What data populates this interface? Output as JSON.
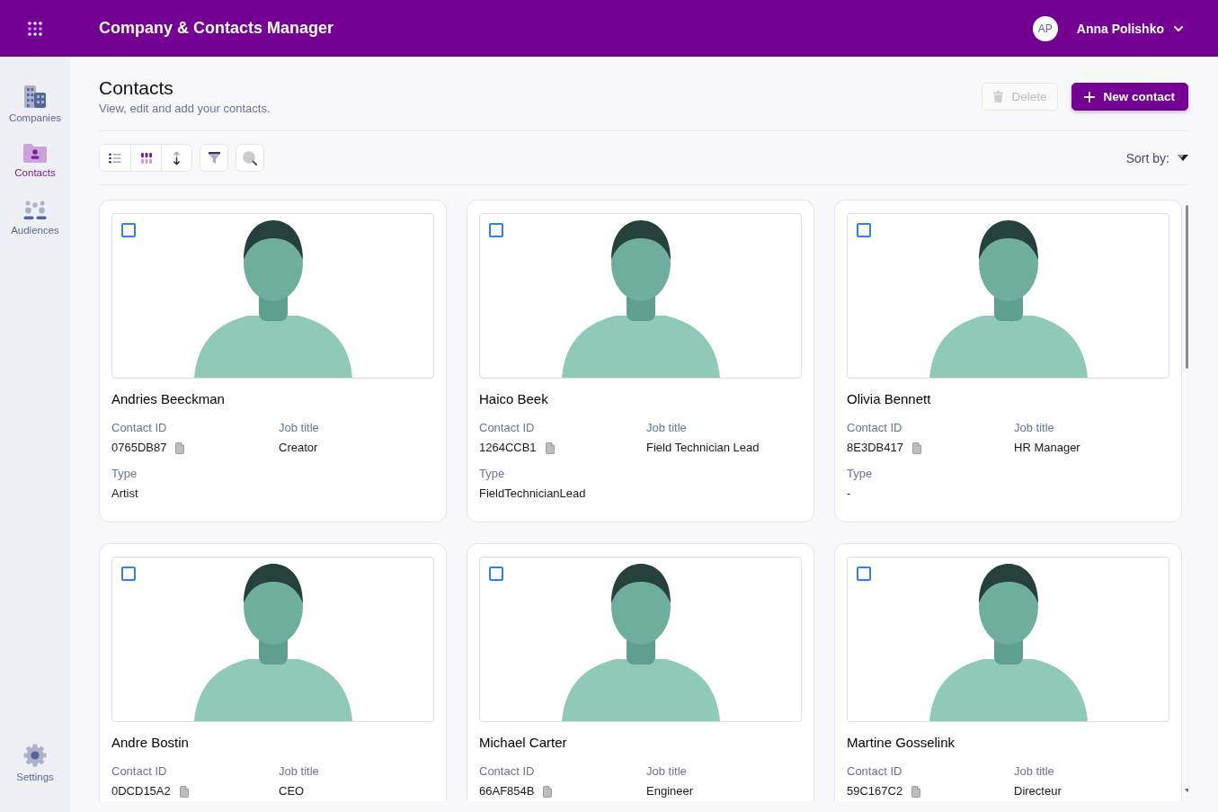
{
  "header": {
    "title": "Company & Contacts Manager",
    "user": {
      "initials": "AP",
      "name": "Anna Polishko"
    }
  },
  "sidebar": {
    "items": [
      {
        "kind": "companies",
        "label": "Companies",
        "selected": false
      },
      {
        "kind": "contacts",
        "label": "Contacts",
        "selected": true
      },
      {
        "kind": "audiences",
        "label": "Audiences",
        "selected": false
      }
    ],
    "footer_items": [
      {
        "kind": "settings",
        "label": "Settings",
        "selected": false
      }
    ]
  },
  "page": {
    "title": "Contacts",
    "subtitle": "View, edit and add your contacts.",
    "actions": [
      {
        "kind": "delete",
        "label": "Delete",
        "disabled": true
      },
      {
        "kind": "create",
        "label": "New contact",
        "disabled": false
      }
    ]
  },
  "toolbar": {
    "segmented": [
      {
        "kind": "list",
        "selected": false
      },
      {
        "kind": "grid",
        "selected": true
      },
      {
        "kind": "order",
        "selected": false
      }
    ],
    "buttons": [
      {
        "kind": "filter"
      },
      {
        "kind": "search"
      }
    ],
    "sort": {
      "label": "Sort by:"
    }
  },
  "contacts": [
    {
      "name": "Andries Beeckman",
      "selected": false,
      "fields": [
        {
          "label": "Contact ID",
          "value": "0765DB87",
          "copyable": true
        },
        {
          "label": "Job title",
          "value": "Creator",
          "copyable": false
        },
        {
          "label": "Type",
          "value": "Artist",
          "copyable": false
        }
      ]
    },
    {
      "name": "Haico Beek",
      "selected": false,
      "fields": [
        {
          "label": "Contact ID",
          "value": "1264CCB1",
          "copyable": true
        },
        {
          "label": "Job title",
          "value": "Field Technician Lead",
          "copyable": false
        },
        {
          "label": "Type",
          "value": "FieldTechnicianLead",
          "copyable": false
        }
      ]
    },
    {
      "name": "Olivia Bennett",
      "selected": false,
      "fields": [
        {
          "label": "Contact ID",
          "value": "8E3DB417",
          "copyable": true
        },
        {
          "label": "Job title",
          "value": "HR Manager",
          "copyable": false
        },
        {
          "label": "Type",
          "value": "-",
          "copyable": false
        }
      ]
    },
    {
      "name": "Andre Bostin",
      "selected": false,
      "fields": [
        {
          "label": "Contact ID",
          "value": "0DCD15A2",
          "copyable": true
        },
        {
          "label": "Job title",
          "value": "CEO",
          "copyable": false
        }
      ]
    },
    {
      "name": "Michael Carter",
      "selected": false,
      "fields": [
        {
          "label": "Contact ID",
          "value": "66AF854B",
          "copyable": true
        },
        {
          "label": "Job title",
          "value": "Engineer",
          "copyable": false
        }
      ]
    },
    {
      "name": "Martine Gosselink",
      "selected": false,
      "fields": [
        {
          "label": "Contact ID",
          "value": "59C167C2",
          "copyable": true
        },
        {
          "label": "Job title",
          "value": "Directeur",
          "copyable": false
        }
      ]
    }
  ]
}
